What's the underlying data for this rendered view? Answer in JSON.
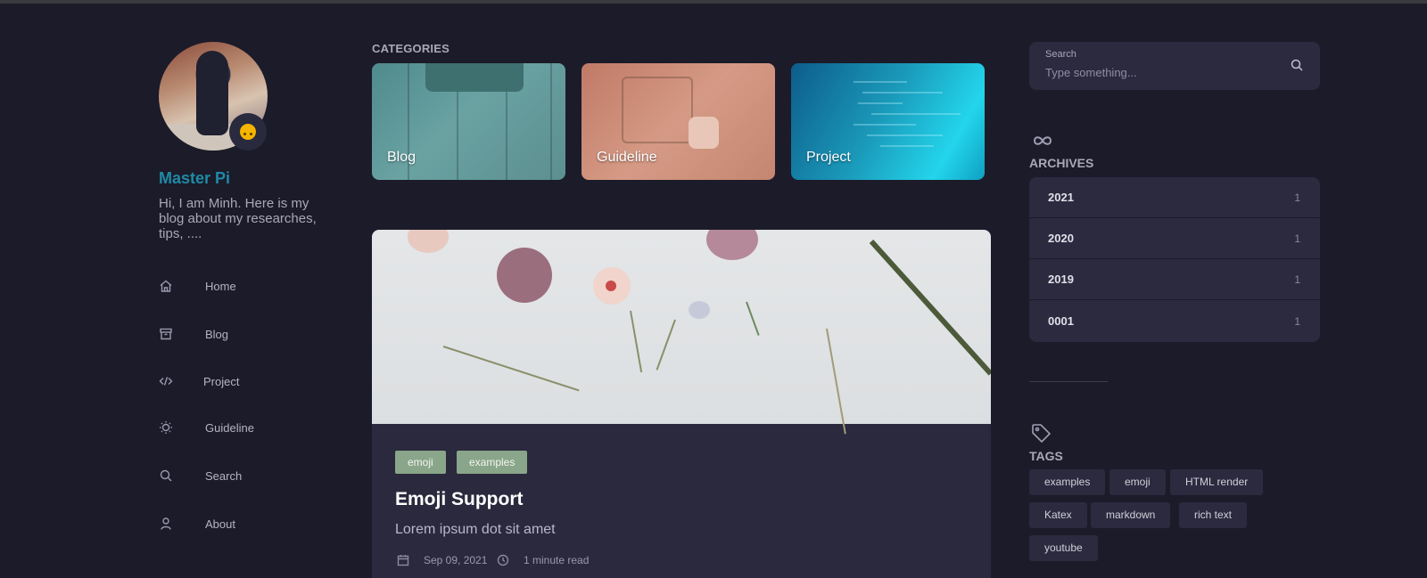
{
  "profile": {
    "name": "Master Pi",
    "bio": "Hi, I am Minh. Here is my blog about my researches, tips, ....",
    "avatar_icon": "profile-photo",
    "badge_icon": "upside-down-face-emoji"
  },
  "nav": {
    "items": [
      {
        "label": "Home",
        "icon": "home-icon"
      },
      {
        "label": "Blog",
        "icon": "archive-box-icon"
      },
      {
        "label": "Project",
        "icon": "code-icon"
      },
      {
        "label": "Guideline",
        "icon": "lightbulb-icon"
      },
      {
        "label": "Search",
        "icon": "search-icon"
      },
      {
        "label": "About",
        "icon": "user-icon"
      }
    ]
  },
  "categories": {
    "title": "CATEGORIES",
    "items": [
      {
        "label": "Blog"
      },
      {
        "label": "Guideline"
      },
      {
        "label": "Project"
      }
    ]
  },
  "post": {
    "tags": [
      "emoji",
      "examples"
    ],
    "title": "Emoji Support",
    "subtitle": "Lorem ipsum dot sit amet",
    "date": "Sep 09, 2021",
    "read_time": "1 minute read",
    "tag_color": "#8aa68a"
  },
  "search": {
    "caption": "Search",
    "placeholder": "Type something..."
  },
  "archives": {
    "title": "ARCHIVES",
    "items": [
      {
        "year": "2021",
        "count": "1"
      },
      {
        "year": "2020",
        "count": "1"
      },
      {
        "year": "2019",
        "count": "1"
      },
      {
        "year": "0001",
        "count": "1"
      }
    ]
  },
  "tags": {
    "title": "TAGS",
    "items": [
      "examples",
      "emoji",
      "HTML render",
      "Katex",
      "markdown",
      "rich text",
      "youtube"
    ]
  },
  "colors": {
    "background": "#1c1b29",
    "card": "#2b2a3f",
    "accent": "#1e8aa6"
  }
}
